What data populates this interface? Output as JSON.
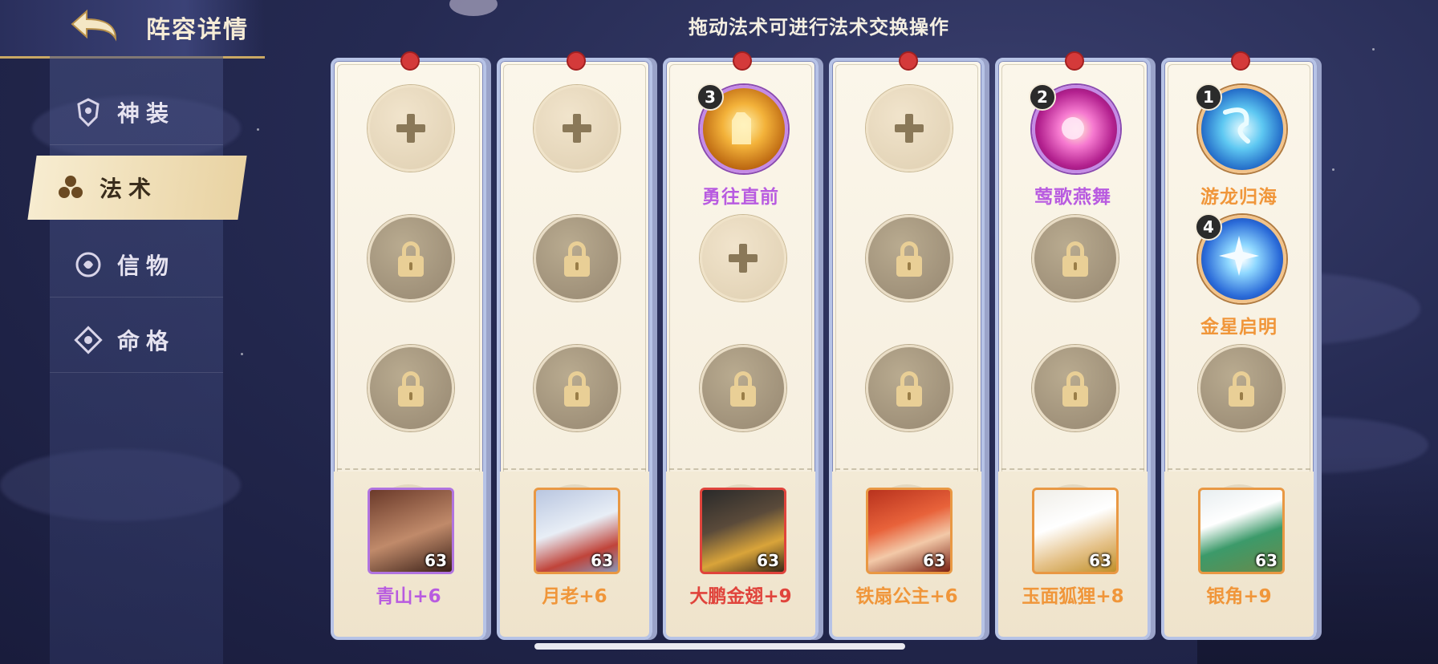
{
  "header": {
    "title": "阵容详情",
    "hint": "拖动法术可进行法术交换操作"
  },
  "sidebar": {
    "items": [
      {
        "label": "神装",
        "icon": "armor-icon",
        "active": false
      },
      {
        "label": "法术",
        "icon": "spell-icon",
        "active": true
      },
      {
        "label": "信物",
        "icon": "token-icon",
        "active": false
      },
      {
        "label": "命格",
        "icon": "fate-icon",
        "active": false
      }
    ]
  },
  "colors": {
    "orange": "#f0963a",
    "purple": "#b85be0",
    "red": "#e0443c",
    "gold": "#c9a864"
  },
  "cards": [
    {
      "slots": [
        {
          "state": "empty"
        },
        {
          "state": "locked"
        },
        {
          "state": "locked"
        }
      ],
      "hero": {
        "name": "青山+6",
        "level": "63",
        "name_color": "#b85be0",
        "frame": "purple"
      }
    },
    {
      "slots": [
        {
          "state": "empty"
        },
        {
          "state": "locked"
        },
        {
          "state": "locked"
        }
      ],
      "hero": {
        "name": "月老+6",
        "level": "63",
        "name_color": "#f0963a",
        "frame": "orange"
      }
    },
    {
      "slots": [
        {
          "state": "spell",
          "num": "3",
          "name": "勇往直前",
          "name_color": "#b85be0"
        },
        {
          "state": "empty"
        },
        {
          "state": "locked"
        }
      ],
      "hero": {
        "name": "大鹏金翅+9",
        "level": "63",
        "name_color": "#e0443c",
        "frame": "orange"
      }
    },
    {
      "slots": [
        {
          "state": "empty"
        },
        {
          "state": "locked"
        },
        {
          "state": "locked"
        }
      ],
      "hero": {
        "name": "铁扇公主+6",
        "level": "63",
        "name_color": "#f0963a",
        "frame": "orange"
      }
    },
    {
      "slots": [
        {
          "state": "spell",
          "num": "2",
          "name": "莺歌燕舞",
          "name_color": "#b85be0"
        },
        {
          "state": "locked"
        },
        {
          "state": "locked"
        }
      ],
      "hero": {
        "name": "玉面狐狸+8",
        "level": "63",
        "name_color": "#f0963a",
        "frame": "orange"
      }
    },
    {
      "slots": [
        {
          "state": "spell",
          "num": "1",
          "name": "游龙归海",
          "name_color": "#f0963a"
        },
        {
          "state": "spell",
          "num": "4",
          "name": "金星启明",
          "name_color": "#f0963a"
        },
        {
          "state": "locked"
        }
      ],
      "hero": {
        "name": "银角+9",
        "level": "63",
        "name_color": "#f0963a",
        "frame": "orange"
      }
    }
  ]
}
